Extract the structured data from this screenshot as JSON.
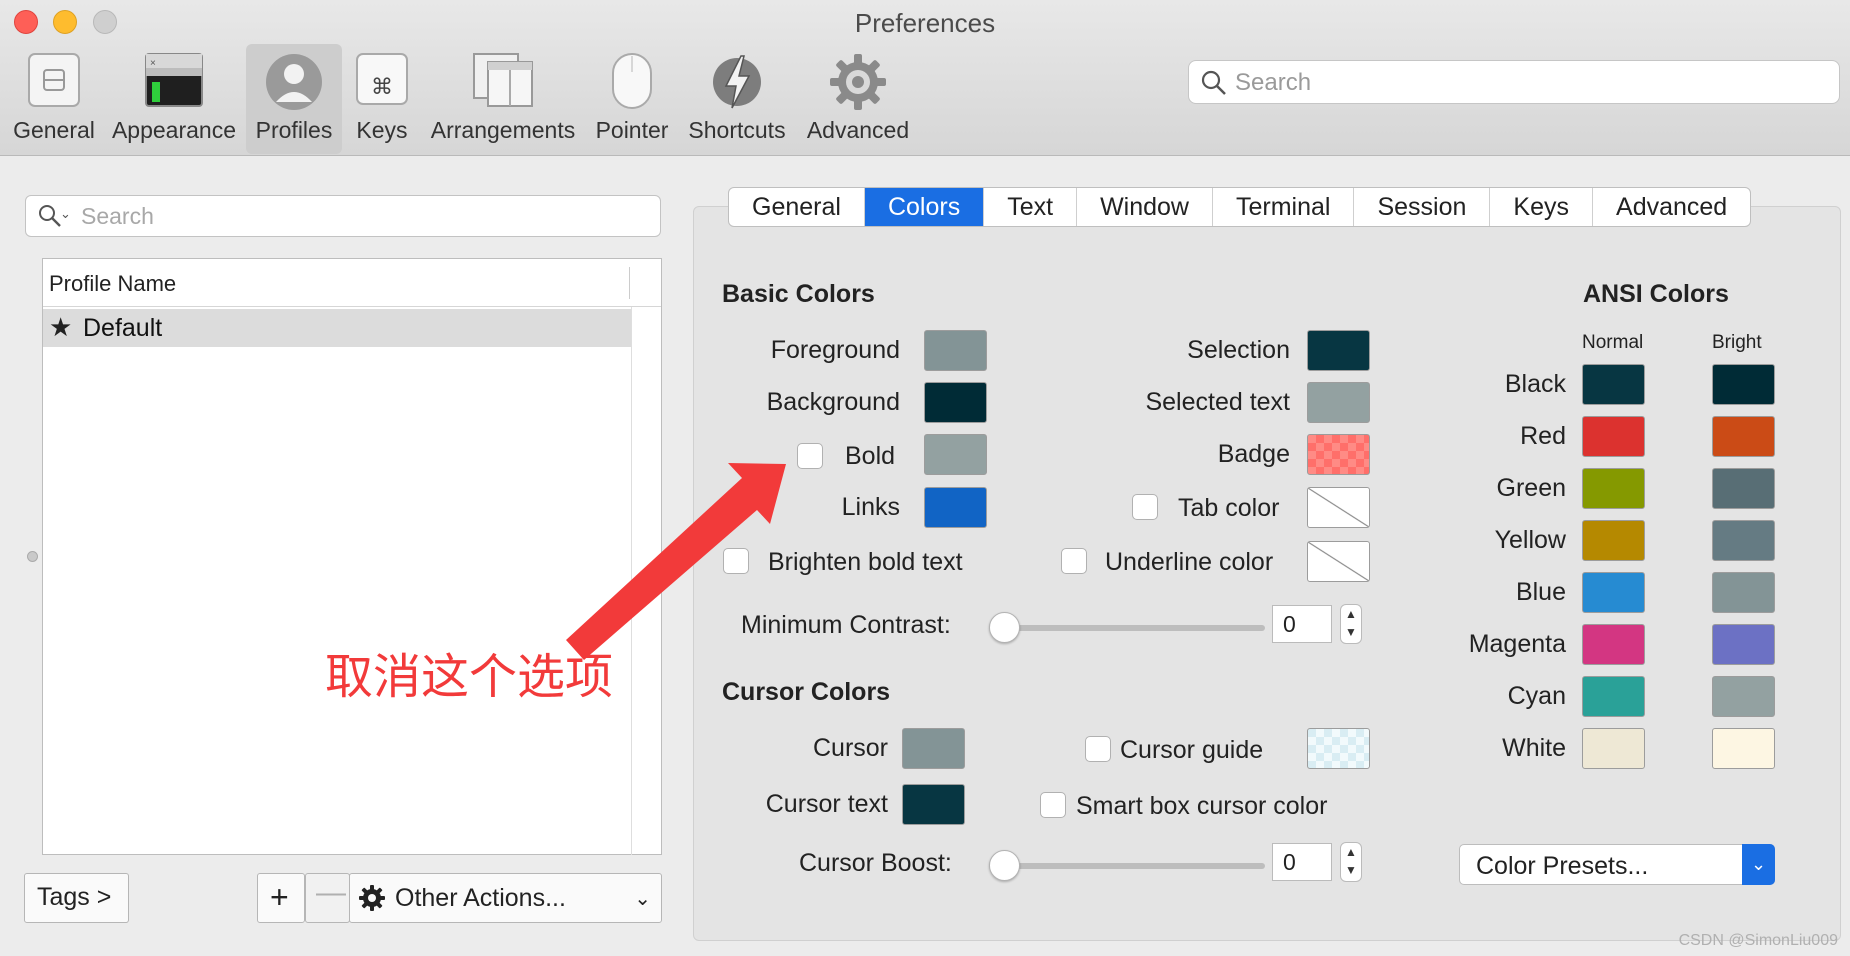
{
  "window": {
    "title": "Preferences"
  },
  "toolbar": {
    "items": [
      {
        "label": "General",
        "icon": "general-icon"
      },
      {
        "label": "Appearance",
        "icon": "appearance-icon"
      },
      {
        "label": "Profiles",
        "icon": "profiles-icon",
        "selected": true
      },
      {
        "label": "Keys",
        "icon": "command-key-icon"
      },
      {
        "label": "Arrangements",
        "icon": "arrangements-icon"
      },
      {
        "label": "Pointer",
        "icon": "mouse-icon"
      },
      {
        "label": "Shortcuts",
        "icon": "lightning-icon"
      },
      {
        "label": "Advanced",
        "icon": "gear-icon"
      }
    ],
    "search_placeholder": "Search"
  },
  "profiles": {
    "search_placeholder": "Search",
    "column_header": "Profile Name",
    "rows": [
      {
        "name": "Default",
        "star": "★"
      }
    ],
    "tags_button": "Tags >",
    "add_button": "+",
    "remove_button": "—",
    "other_actions_button": "Other Actions..."
  },
  "tabs": [
    {
      "label": "General"
    },
    {
      "label": "Colors",
      "active": true
    },
    {
      "label": "Text"
    },
    {
      "label": "Window"
    },
    {
      "label": "Terminal"
    },
    {
      "label": "Session"
    },
    {
      "label": "Keys"
    },
    {
      "label": "Advanced"
    }
  ],
  "basic_colors": {
    "title": "Basic Colors",
    "foreground": {
      "label": "Foreground",
      "color": "#839496"
    },
    "background": {
      "label": "Background",
      "color": "#002b36"
    },
    "bold": {
      "label": "Bold",
      "color": "#93a1a1",
      "checked": false
    },
    "links": {
      "label": "Links",
      "color": "#1164c5"
    },
    "selection": {
      "label": "Selection",
      "color": "#073642"
    },
    "selected_text": {
      "label": "Selected text",
      "color": "#93a1a1"
    },
    "badge": {
      "label": "Badge",
      "color": "#ff8b85"
    },
    "tab_color": {
      "label": "Tab color",
      "checked": false
    },
    "underline_color": {
      "label": "Underline color",
      "checked": false
    },
    "brighten_bold": {
      "label": "Brighten bold text",
      "checked": false
    },
    "min_contrast": {
      "label": "Minimum Contrast:",
      "value": "0",
      "level": 0
    }
  },
  "cursor_colors": {
    "title": "Cursor Colors",
    "cursor": {
      "label": "Cursor",
      "color": "#839496"
    },
    "cursor_text": {
      "label": "Cursor text",
      "color": "#073642"
    },
    "cursor_guide": {
      "label": "Cursor guide",
      "checked": false
    },
    "smart_box": {
      "label": "Smart box cursor color",
      "checked": false
    },
    "cursor_boost": {
      "label": "Cursor Boost:",
      "value": "0",
      "level": 0
    }
  },
  "ansi": {
    "title": "ANSI Colors",
    "normal_header": "Normal",
    "bright_header": "Bright",
    "rows": [
      {
        "name": "Black",
        "normal": "#073642",
        "bright": "#002b36"
      },
      {
        "name": "Red",
        "normal": "#dc322f",
        "bright": "#cb4b16"
      },
      {
        "name": "Green",
        "normal": "#859900",
        "bright": "#586e75"
      },
      {
        "name": "Yellow",
        "normal": "#b58900",
        "bright": "#657b83"
      },
      {
        "name": "Blue",
        "normal": "#268bd2",
        "bright": "#839496"
      },
      {
        "name": "Magenta",
        "normal": "#d33682",
        "bright": "#6c71c4"
      },
      {
        "name": "Cyan",
        "normal": "#2aa198",
        "bright": "#93a1a1"
      },
      {
        "name": "White",
        "normal": "#eee8d5",
        "bright": "#fdf6e3"
      }
    ]
  },
  "color_presets": {
    "label": "Color Presets..."
  },
  "annotation": {
    "text": "取消这个选项",
    "color": "#f23a3a"
  },
  "watermark": "CSDN @SimonLiu009"
}
